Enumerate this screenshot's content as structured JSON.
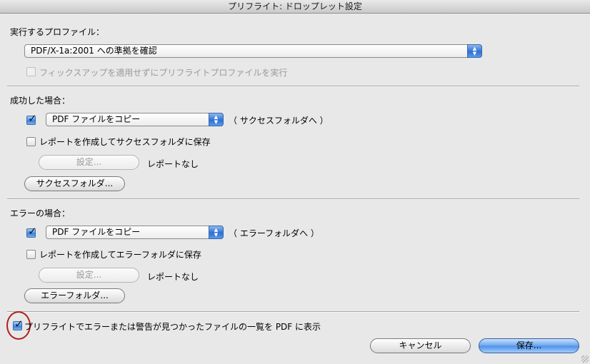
{
  "window": {
    "title": "プリフライト: ドロップレット設定"
  },
  "profile": {
    "label": "実行するプロファイル：",
    "selected": "PDF/X-1a:2001 への準拠を確認",
    "no_fixup_label": "フィックスアップを適用せずにプリフライトプロファイルを実行",
    "no_fixup_checked": false,
    "no_fixup_enabled": false
  },
  "success": {
    "label": "成功した場合：",
    "copy_checked": true,
    "action_selected": "PDF ファイルをコピー",
    "target_note": "（ サクセスフォルダへ ）",
    "report_label": "レポートを作成してサクセスフォルダに保存",
    "report_checked": false,
    "settings_button": "設定...",
    "report_status": "レポートなし",
    "folder_button": "サクセスフォルダ..."
  },
  "error": {
    "label": "エラーの場合：",
    "copy_checked": true,
    "action_selected": "PDF ファイルをコピー",
    "target_note": "（ エラーフォルダへ ）",
    "report_label": "レポートを作成してエラーフォルダに保存",
    "report_checked": false,
    "settings_button": "設定...",
    "report_status": "レポートなし",
    "folder_button": "エラーフォルダ..."
  },
  "summary": {
    "label": "プリフライトでエラーまたは警告が見つかったファイルの一覧を PDF に表示",
    "checked": true
  },
  "footer": {
    "cancel": "キャンセル",
    "save": "保存..."
  },
  "colors": {
    "accent": "#4b90ea",
    "highlight_circle": "#b51d1d"
  }
}
